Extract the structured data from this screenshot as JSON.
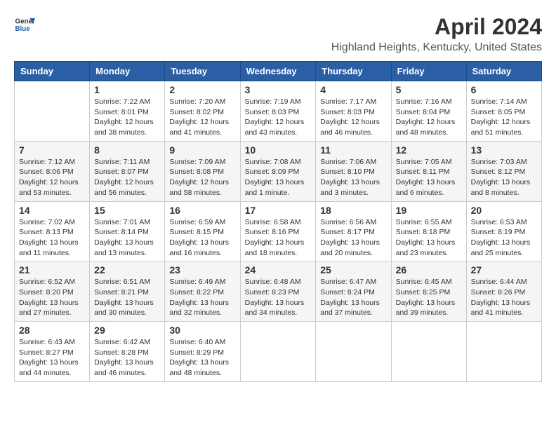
{
  "header": {
    "logo_general": "General",
    "logo_blue": "Blue",
    "title": "April 2024",
    "subtitle": "Highland Heights, Kentucky, United States"
  },
  "calendar": {
    "days_of_week": [
      "Sunday",
      "Monday",
      "Tuesday",
      "Wednesday",
      "Thursday",
      "Friday",
      "Saturday"
    ],
    "weeks": [
      [
        {
          "day": "",
          "info": ""
        },
        {
          "day": "1",
          "info": "Sunrise: 7:22 AM\nSunset: 8:01 PM\nDaylight: 12 hours\nand 38 minutes."
        },
        {
          "day": "2",
          "info": "Sunrise: 7:20 AM\nSunset: 8:02 PM\nDaylight: 12 hours\nand 41 minutes."
        },
        {
          "day": "3",
          "info": "Sunrise: 7:19 AM\nSunset: 8:03 PM\nDaylight: 12 hours\nand 43 minutes."
        },
        {
          "day": "4",
          "info": "Sunrise: 7:17 AM\nSunset: 8:03 PM\nDaylight: 12 hours\nand 46 minutes."
        },
        {
          "day": "5",
          "info": "Sunrise: 7:16 AM\nSunset: 8:04 PM\nDaylight: 12 hours\nand 48 minutes."
        },
        {
          "day": "6",
          "info": "Sunrise: 7:14 AM\nSunset: 8:05 PM\nDaylight: 12 hours\nand 51 minutes."
        }
      ],
      [
        {
          "day": "7",
          "info": "Sunrise: 7:12 AM\nSunset: 8:06 PM\nDaylight: 12 hours\nand 53 minutes."
        },
        {
          "day": "8",
          "info": "Sunrise: 7:11 AM\nSunset: 8:07 PM\nDaylight: 12 hours\nand 56 minutes."
        },
        {
          "day": "9",
          "info": "Sunrise: 7:09 AM\nSunset: 8:08 PM\nDaylight: 12 hours\nand 58 minutes."
        },
        {
          "day": "10",
          "info": "Sunrise: 7:08 AM\nSunset: 8:09 PM\nDaylight: 13 hours\nand 1 minute."
        },
        {
          "day": "11",
          "info": "Sunrise: 7:06 AM\nSunset: 8:10 PM\nDaylight: 13 hours\nand 3 minutes."
        },
        {
          "day": "12",
          "info": "Sunrise: 7:05 AM\nSunset: 8:11 PM\nDaylight: 13 hours\nand 6 minutes."
        },
        {
          "day": "13",
          "info": "Sunrise: 7:03 AM\nSunset: 8:12 PM\nDaylight: 13 hours\nand 8 minutes."
        }
      ],
      [
        {
          "day": "14",
          "info": "Sunrise: 7:02 AM\nSunset: 8:13 PM\nDaylight: 13 hours\nand 11 minutes."
        },
        {
          "day": "15",
          "info": "Sunrise: 7:01 AM\nSunset: 8:14 PM\nDaylight: 13 hours\nand 13 minutes."
        },
        {
          "day": "16",
          "info": "Sunrise: 6:59 AM\nSunset: 8:15 PM\nDaylight: 13 hours\nand 16 minutes."
        },
        {
          "day": "17",
          "info": "Sunrise: 6:58 AM\nSunset: 8:16 PM\nDaylight: 13 hours\nand 18 minutes."
        },
        {
          "day": "18",
          "info": "Sunrise: 6:56 AM\nSunset: 8:17 PM\nDaylight: 13 hours\nand 20 minutes."
        },
        {
          "day": "19",
          "info": "Sunrise: 6:55 AM\nSunset: 8:18 PM\nDaylight: 13 hours\nand 23 minutes."
        },
        {
          "day": "20",
          "info": "Sunrise: 6:53 AM\nSunset: 8:19 PM\nDaylight: 13 hours\nand 25 minutes."
        }
      ],
      [
        {
          "day": "21",
          "info": "Sunrise: 6:52 AM\nSunset: 8:20 PM\nDaylight: 13 hours\nand 27 minutes."
        },
        {
          "day": "22",
          "info": "Sunrise: 6:51 AM\nSunset: 8:21 PM\nDaylight: 13 hours\nand 30 minutes."
        },
        {
          "day": "23",
          "info": "Sunrise: 6:49 AM\nSunset: 8:22 PM\nDaylight: 13 hours\nand 32 minutes."
        },
        {
          "day": "24",
          "info": "Sunrise: 6:48 AM\nSunset: 8:23 PM\nDaylight: 13 hours\nand 34 minutes."
        },
        {
          "day": "25",
          "info": "Sunrise: 6:47 AM\nSunset: 8:24 PM\nDaylight: 13 hours\nand 37 minutes."
        },
        {
          "day": "26",
          "info": "Sunrise: 6:45 AM\nSunset: 8:25 PM\nDaylight: 13 hours\nand 39 minutes."
        },
        {
          "day": "27",
          "info": "Sunrise: 6:44 AM\nSunset: 8:26 PM\nDaylight: 13 hours\nand 41 minutes."
        }
      ],
      [
        {
          "day": "28",
          "info": "Sunrise: 6:43 AM\nSunset: 8:27 PM\nDaylight: 13 hours\nand 44 minutes."
        },
        {
          "day": "29",
          "info": "Sunrise: 6:42 AM\nSunset: 8:28 PM\nDaylight: 13 hours\nand 46 minutes."
        },
        {
          "day": "30",
          "info": "Sunrise: 6:40 AM\nSunset: 8:29 PM\nDaylight: 13 hours\nand 48 minutes."
        },
        {
          "day": "",
          "info": ""
        },
        {
          "day": "",
          "info": ""
        },
        {
          "day": "",
          "info": ""
        },
        {
          "day": "",
          "info": ""
        }
      ]
    ]
  }
}
